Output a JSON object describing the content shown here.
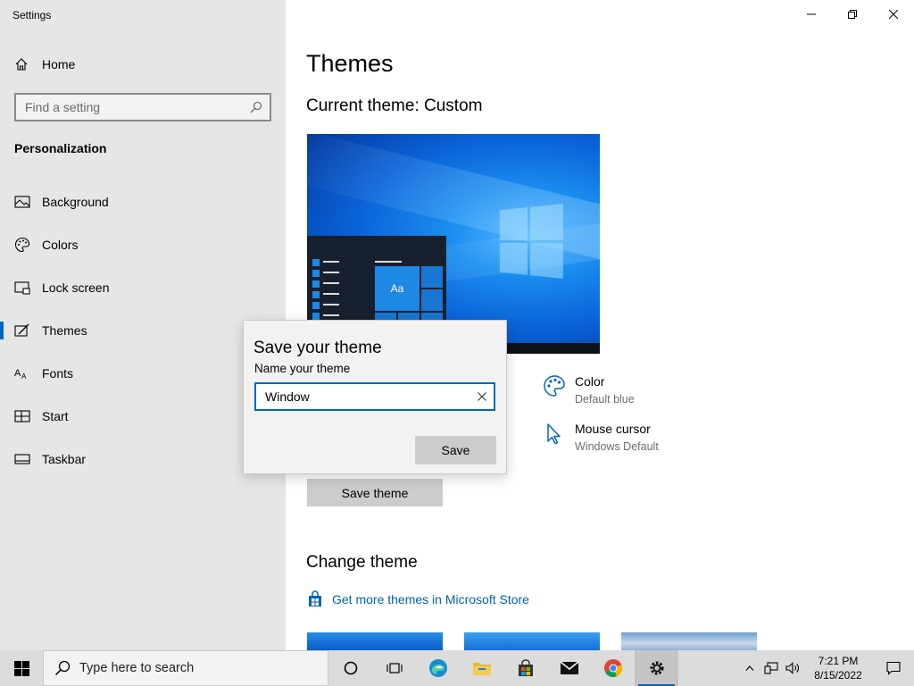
{
  "window": {
    "title": "Settings",
    "controls": [
      "minimize-icon",
      "restore-icon",
      "close-icon"
    ]
  },
  "sidebar": {
    "home_label": "Home",
    "search_placeholder": "Find a setting",
    "section_title": "Personalization",
    "items": [
      {
        "label": "Background",
        "icon": "picture-icon"
      },
      {
        "label": "Colors",
        "icon": "palette-icon"
      },
      {
        "label": "Lock screen",
        "icon": "lock-screen-icon"
      },
      {
        "label": "Themes",
        "icon": "themes-icon",
        "active": true
      },
      {
        "label": "Fonts",
        "icon": "fonts-icon"
      },
      {
        "label": "Start",
        "icon": "start-icon"
      },
      {
        "label": "Taskbar",
        "icon": "taskbar-icon"
      }
    ]
  },
  "main": {
    "title": "Themes",
    "current_theme": "Current theme: Custom",
    "preview_tile_text": "Aa",
    "color": {
      "name": "Color",
      "value": "Default blue"
    },
    "cursor": {
      "name": "Mouse cursor",
      "value": "Windows Default"
    },
    "save_theme_button": "Save theme",
    "change_theme_title": "Change theme",
    "store_link": "Get more themes in Microsoft Store"
  },
  "dialog": {
    "title": "Save your theme",
    "label": "Name your theme",
    "input_value": "Window",
    "save_button": "Save"
  },
  "taskbar": {
    "search_placeholder": "Type here to search",
    "apps": [
      "cortana-icon",
      "task-view-icon",
      "edge-icon",
      "file-explorer-icon",
      "store-icon",
      "mail-icon",
      "chrome-icon",
      "settings-icon"
    ],
    "time": "7:21 PM",
    "date": "8/15/2022"
  },
  "colors": {
    "accent": "#0067c0",
    "sidebar_bg": "#e6e6e6",
    "link": "#0063b1"
  }
}
